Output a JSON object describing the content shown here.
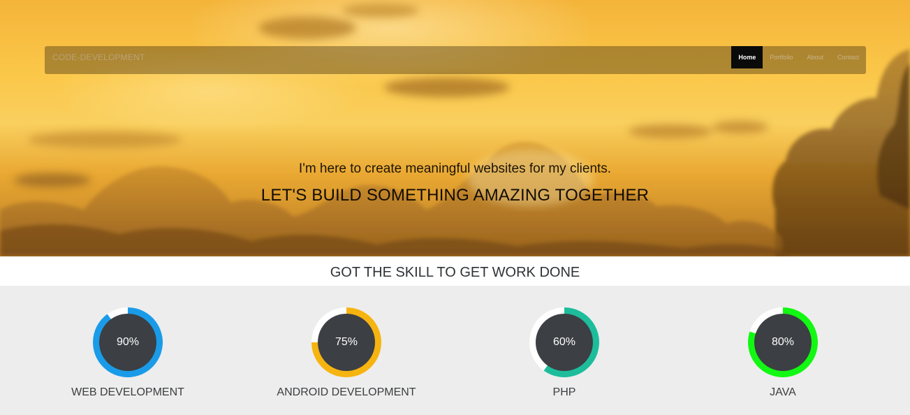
{
  "navbar": {
    "brand": "CODE-DEVELOPMENT",
    "items": [
      {
        "label": "Home",
        "active": true
      },
      {
        "label": "Portfolio",
        "active": false
      },
      {
        "label": "About",
        "active": false
      },
      {
        "label": "Contact",
        "active": false
      }
    ]
  },
  "hero": {
    "subtitle": "I'm here to create meaningful websites for my clients.",
    "title": "LET'S BUILD SOMETHING AMAZING TOGETHER"
  },
  "skills": {
    "heading": "GOT THE SKILL TO GET WORK DONE",
    "items": [
      {
        "name": "WEB DEVELOPMENT",
        "percent_label": "90%",
        "progress": 0.9,
        "color": "#1a9be8"
      },
      {
        "name": "ANDROID DEVELOPMENT",
        "percent_label": "75%",
        "progress": 0.75,
        "color": "#f6b411"
      },
      {
        "name": "PHP",
        "percent_label": "60%",
        "progress": 0.6,
        "color": "#1dbd9c"
      },
      {
        "name": "JAVA",
        "percent_label": "80%",
        "progress": 0.8,
        "color": "#12f812"
      }
    ]
  },
  "colors": {
    "ring_inner": "#3c3f43",
    "ring_track": "#ffffff",
    "nav_active_bg": "#0a0a0a"
  }
}
